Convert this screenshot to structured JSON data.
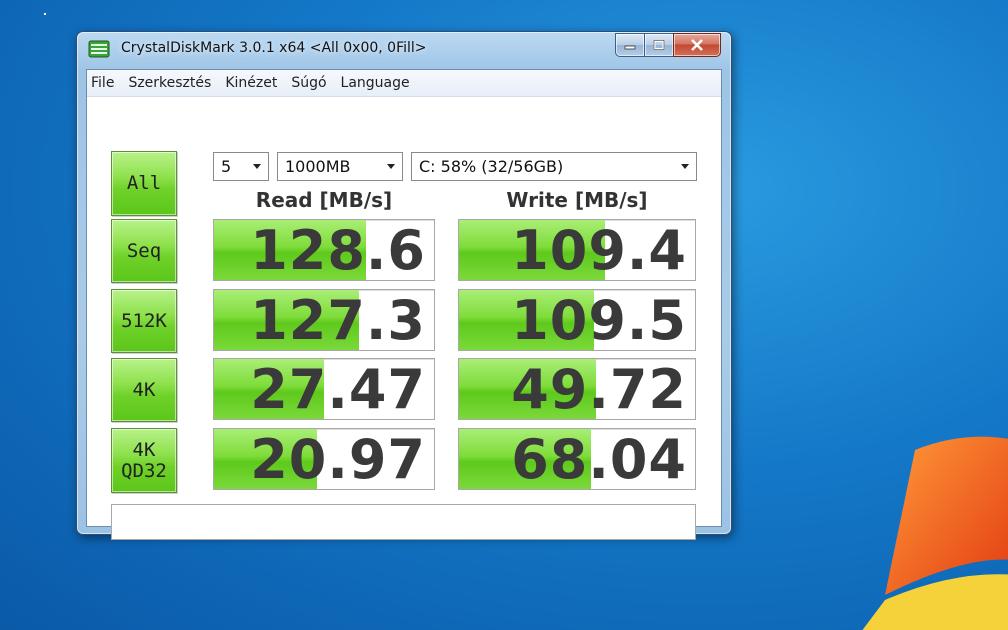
{
  "window": {
    "title": "CrystalDiskMark 3.0.1 x64 <All 0x00, 0Fill>"
  },
  "menu": [
    "File",
    "Szerkesztés",
    "Kinézet",
    "Súgó",
    "Language"
  ],
  "controls": {
    "all_button": "All",
    "count": "5",
    "size": "1000MB",
    "drive": "C: 58% (32/56GB)"
  },
  "headers": {
    "read": "Read [MB/s]",
    "write": "Write [MB/s]"
  },
  "rows": [
    {
      "label": "Seq",
      "read": "128.6",
      "write": "109.4",
      "read_fill": 0.69,
      "write_fill": 0.62
    },
    {
      "label": "512K",
      "read": "127.3",
      "write": "109.5",
      "read_fill": 0.66,
      "write_fill": 0.57
    },
    {
      "label": "4K",
      "read": "27.47",
      "write": "49.72",
      "read_fill": 0.5,
      "write_fill": 0.58
    },
    {
      "label": "4K\nQD32",
      "read": "20.97",
      "write": "68.04",
      "read_fill": 0.47,
      "write_fill": 0.56
    }
  ],
  "comment": "",
  "icons": {
    "app": "disk-icon",
    "minimize": "minimize-icon",
    "maximize": "maximize-icon",
    "close": "close-icon"
  },
  "colors": {
    "button_green": "#6fd129",
    "bar_green": "#7fdc3a",
    "desktop_blue": "#1478c8"
  }
}
